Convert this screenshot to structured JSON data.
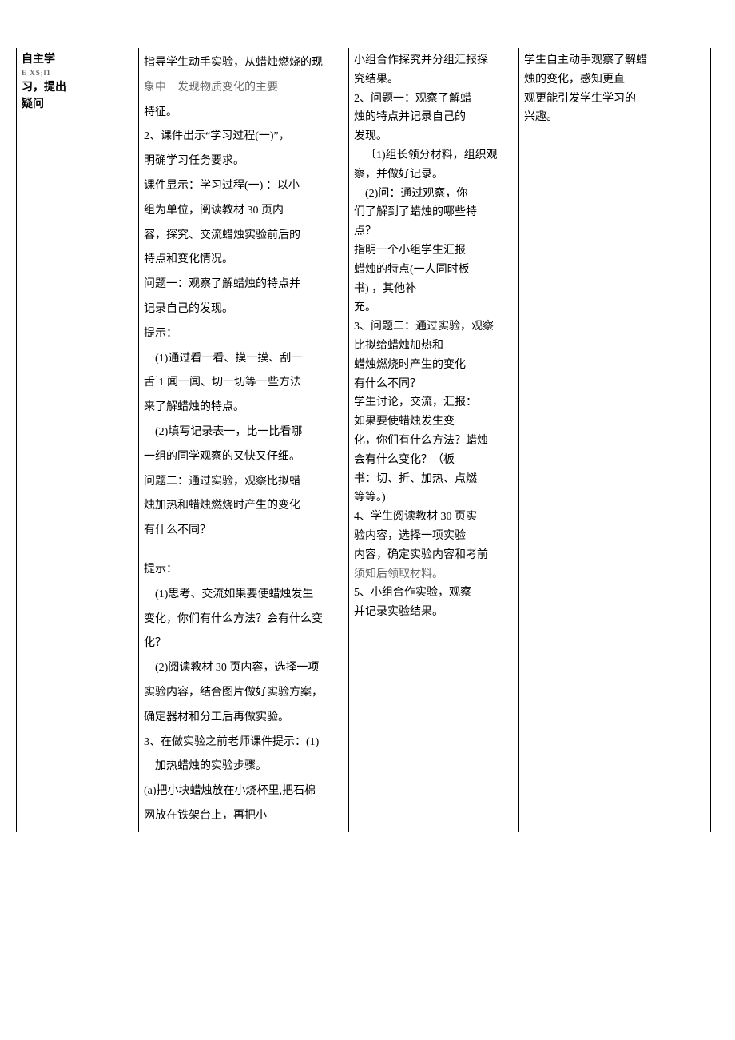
{
  "col1": {
    "line1": "自主学",
    "tiny": "E    XS;l1",
    "line2": "习，提出",
    "line3": "疑问"
  },
  "col2": {
    "p1": "指导学生动手实验，从蜡烛燃烧的现",
    "p2_faded": "象中　发现物质变化的主要",
    "p3": "特征。",
    "p4": "2、课件出示“学习过程(一)”，",
    "p5": "明确学习任务要求。",
    "p6": "课件显示：学习过程(一) ：以小",
    "p7": "组为单位，阅读教材 30 页内",
    "p8": "容，探究、交流蜡烛实验前后的",
    "p9": "特点和变化情况。",
    "p10": "问题一：观察了解蜡烛的特点并",
    "p11": "记录自己的发现。",
    "p12": "提示：",
    "p13": "(1)通过看一看、摸一摸、刮一",
    "p14a": "舌",
    "p14sup": "1",
    "p14b": "1 闻一闻、切一切等一些方法",
    "p15": "来了解蜡烛的特点。",
    "p16": "(2)填写记录表一，比一比看哪",
    "p17": "一组的同学观察的又快又仔细。",
    "p18": "问题二：通过实验，观察比拟蜡",
    "p19": "烛加热和蜡烛燃烧时产生的变化",
    "p20": "有什么不同？",
    "p21": "提示：",
    "p22": "(1)思考、交流如果要使蜡烛发生",
    "p23": "变化，你们有什么方法？会有什么变",
    "p24": "化？",
    "p25": "(2)阅读教材 30 页内容，选择一项",
    "p26": "实验内容，结合图片做好实验方案，",
    "p27": "确定器材和分工后再做实验。",
    "p28": "3、在做实验之前老师课件提示：(1)",
    "p29": "加热蜡烛的实验步骤。",
    "p30": "(a)把小块蜡烛放在小烧杯里,把石棉",
    "p31": "网放在铁架台上，再把小"
  },
  "col3": {
    "p1": "小组合作探究并分组汇报探",
    "p2": "究结果。",
    "p3": "2、问题一：观察了解蜡",
    "p4": "烛的特点并记录自己的",
    "p5": "发现。",
    "p6": "〔1)组长领分材料，组织观",
    "p7": "察，并做好记录。",
    "p8": "(2)问：通过观察，你",
    "p9": "们了解到了蜡烛的哪些特",
    "p10": "点？",
    "p11": "指明一个小组学生汇报",
    "p12": "蜡烛的特点(一人同时板",
    "p13": "书)    ，其他补",
    "p14": "充。",
    "p15": "3、问题二：通过实验，观察",
    "p16": "比拟给蜡烛加热和",
    "p17": "蜡烛燃烧时产生的变化",
    "p18": "有什么不同？",
    "p19": "学生讨论，交流，汇报：",
    "p20": "如果要使蜡烛发生变",
    "p21": "化，你们有什么方法？蜡烛",
    "p22": "会有什么变化？（板",
    "p23": "书：切、折、加热、点燃",
    "p24": "等等。)",
    "p25": "4、学生阅读教材 30 页实",
    "p26": "验内容，选择一项实验",
    "p27": "内容，确定实验内容和考前",
    "p28_faded": "须知后领取材料。",
    "p29": "5、小组合作实验，观察",
    "p30": "并记录实验结果。"
  },
  "col4": {
    "p1": "学生自主动手观察了解蜡",
    "p2": "烛的变化，感知更直",
    "p3": "观更能引发学生学习的",
    "p4": "兴趣。"
  }
}
